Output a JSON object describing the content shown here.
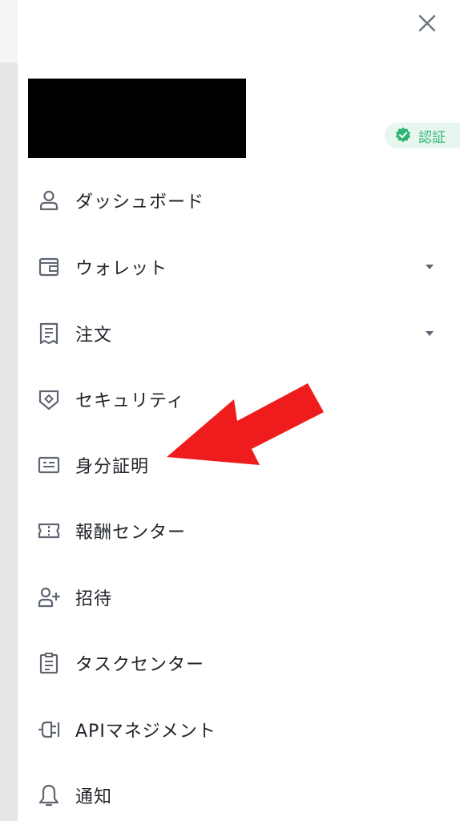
{
  "header": {
    "close_icon": "close-icon"
  },
  "badge": {
    "label": "認証",
    "color": "#2fb672",
    "icon": "verified-check-icon"
  },
  "menu": {
    "items": [
      {
        "label": "ダッシュボード",
        "icon": "user-icon",
        "has_caret": false
      },
      {
        "label": "ウォレット",
        "icon": "wallet-icon",
        "has_caret": true
      },
      {
        "label": "注文",
        "icon": "receipt-icon",
        "has_caret": true
      },
      {
        "label": "セキュリティ",
        "icon": "shield-icon",
        "has_caret": false
      },
      {
        "label": "身分証明",
        "icon": "id-card-icon",
        "has_caret": false
      },
      {
        "label": "報酬センター",
        "icon": "ticket-icon",
        "has_caret": false
      },
      {
        "label": "招待",
        "icon": "add-user-icon",
        "has_caret": false
      },
      {
        "label": "タスクセンター",
        "icon": "clipboard-icon",
        "has_caret": false
      },
      {
        "label": "APIマネジメント",
        "icon": "plug-icon",
        "has_caret": false
      },
      {
        "label": "通知",
        "icon": "bell-icon",
        "has_caret": false
      }
    ]
  },
  "annotation": {
    "arrow_color": "#ee1c1c",
    "target": "身分証明"
  }
}
